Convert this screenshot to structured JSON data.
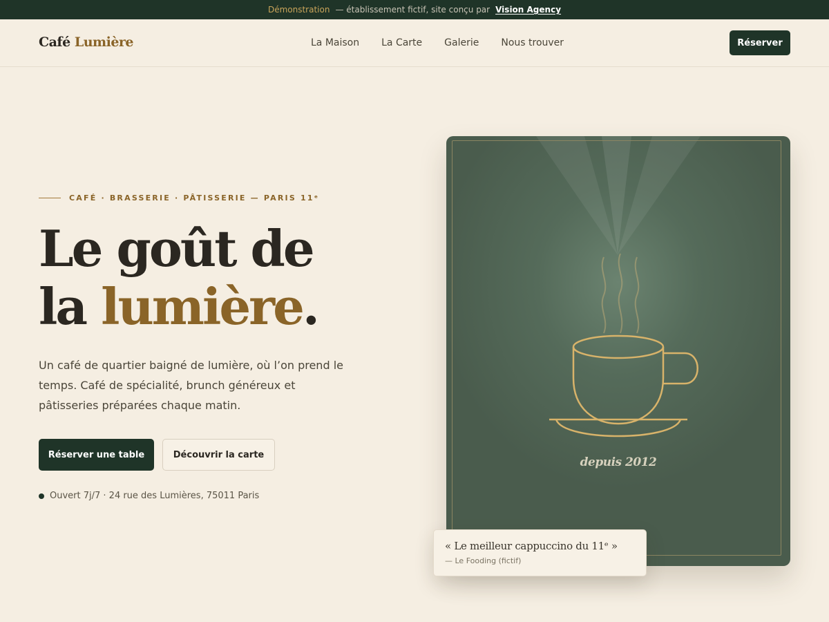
{
  "banner": {
    "label": "Démonstration",
    "text": "— établissement fictif, site conçu par",
    "agency": "Vision Agency"
  },
  "header": {
    "logo_part1": "Café",
    "logo_part2": "Lumière",
    "nav": [
      "La Maison",
      "La Carte",
      "Galerie",
      "Nous trouver"
    ],
    "cta": "Réserver"
  },
  "hero": {
    "eyebrow": "CAFÉ · BRASSERIE · PÂTISSERIE — PARIS 11ᵉ",
    "headline_line1": "Le goût de",
    "headline_line2_a": "la",
    "headline_line2_b": "lumière",
    "headline_line2_c": ".",
    "intro": "Un café de quartier baigné de lumière, où l’on prend le temps. Café de spécialité, brunch généreux et pâtisseries préparées chaque matin.",
    "primary_button": "Réserver une table",
    "secondary_button": "Découvrir la carte",
    "info": "Ouvert 7j/7 · 24 rue des Lumières, 75011 Paris"
  },
  "card": {
    "since": "depuis 2012",
    "icon": "coffee-cup-illustration"
  },
  "quote": {
    "text": "« Le meilleur cappuccino du 11ᵉ »",
    "source": "— Le Fooding (fictif)"
  },
  "colors": {
    "background": "#f5eee2",
    "dark_green": "#1f3428",
    "gold": "#8a6428",
    "card_green": "#4f6453",
    "line_gold": "#d8b36a"
  }
}
